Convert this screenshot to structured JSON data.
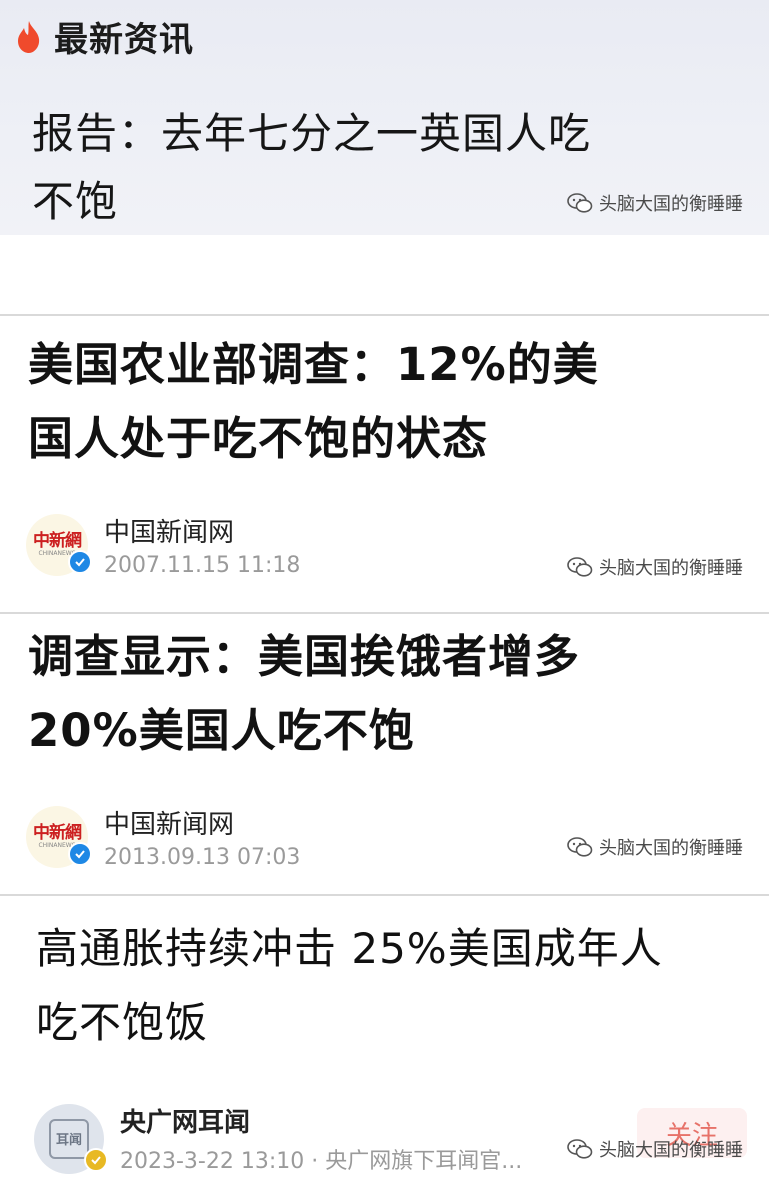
{
  "panel1": {
    "section_title": "最新资讯",
    "section_icon": "fire-icon",
    "headline_line1": "报告：去年七分之一英国人吃",
    "headline_line2": "不饱",
    "watermark": "头脑大国的衡睡睡"
  },
  "panel2": {
    "title_line1": "美国农业部调查：12%的美",
    "title_line2": "国人处于吃不饱的状态",
    "logo_text": "中新網",
    "logo_sub": "CHINANEWS",
    "source": "中国新闻网",
    "time": "2007.11.15  11:18",
    "watermark": "头脑大国的衡睡睡"
  },
  "panel3": {
    "title_line1": "调查显示：美国挨饿者增多",
    "title_line2": "20%美国人吃不饱",
    "logo_text": "中新網",
    "logo_sub": "CHINANEWS",
    "source": "中国新闻网",
    "time": "2013.09.13  07:03",
    "watermark": "头脑大国的衡睡睡"
  },
  "panel4": {
    "title_line1": "高通胀持续冲击 25%美国成年人",
    "title_line2": "吃不饱饭",
    "logo_text": "耳闻",
    "source": "央广网耳闻",
    "time": "2023-3-22 13:10 · 央广网旗下耳闻官...",
    "follow_label": "关注",
    "watermark": "头脑大国的衡睡睡"
  },
  "colors": {
    "fire": "#f04a2c",
    "verified_blue": "#1e88e5",
    "verified_gold": "#e8b923",
    "follow_text": "#e35a4f"
  }
}
